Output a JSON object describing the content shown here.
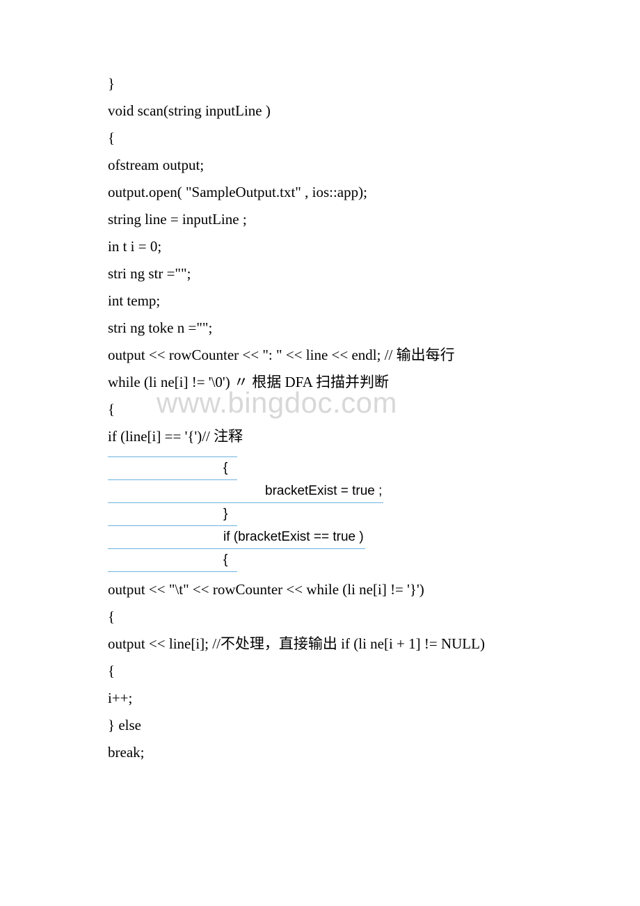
{
  "watermark": "www.bingdoc.com",
  "lines": {
    "l1": "}",
    "l2": "void scan(string inputLine )",
    "l3": "{",
    "l4": "ofstream output;",
    "l5": "output.open( \"SampleOutput.txt\" , ios::app);",
    "l6": "string line = inputLine ;",
    "l7": "in t i = 0;",
    "l8": "stri ng str =\"\";",
    "l9": "int temp;",
    "l10": "stri ng toke n =\"\";",
    "l11": "output << rowCounter << \": \" << line << endl; // 输出每行",
    "l12": "while (li ne[i] != '\\0') 〃 根据 DFA 扫描并判断",
    "l13": "{",
    "l14": "if (line[i] == '{')// 注释",
    "l15": "output << \"\\t\" << rowCounter << while (li ne[i] != '}')",
    "l16": "{",
    "l17": "output << line[i]; //不处理，直接输出 if (li ne[i + 1] != NULL)",
    "l18": "{",
    "l19": "i++;",
    "l20": "} else",
    "l21": "break;"
  },
  "table": {
    "r1": "{",
    "r2": "bracketExist =  true ;",
    "r3": "}",
    "r4": "if (bracketExist ==  true )",
    "r5": "{"
  }
}
